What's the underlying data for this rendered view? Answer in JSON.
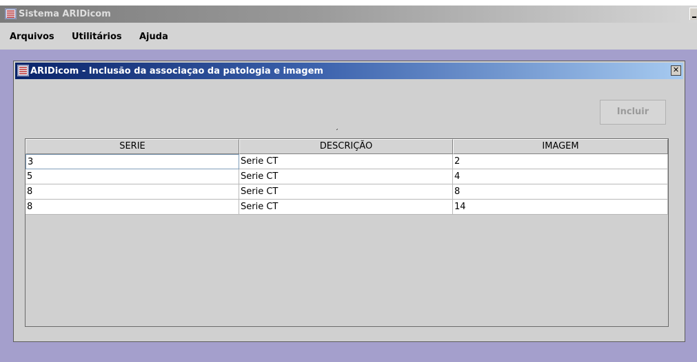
{
  "app": {
    "title": "Sistema ARIDicom"
  },
  "menu": {
    "items": [
      "Arquivos",
      "Utilitários",
      "Ajuda"
    ]
  },
  "dialog": {
    "title": "ARIDicom - Inclusão da associaçao da patologia e imagem",
    "close_label": "✕",
    "incluir_label": "Incluir",
    "caret": "ˊ"
  },
  "table": {
    "columns": [
      "SERIE",
      "DESCRIÇÃO",
      "IMAGEM"
    ],
    "rows": [
      [
        "3",
        "Serie CT",
        "2"
      ],
      [
        "5",
        "Serie CT",
        "4"
      ],
      [
        "8",
        "Serie CT",
        "8"
      ],
      [
        "8",
        "Serie CT",
        "14"
      ]
    ]
  },
  "colors": {
    "desktop": "#a49fcc",
    "active_title": "#0a246a",
    "inactive_title": "#7b7b7b"
  }
}
